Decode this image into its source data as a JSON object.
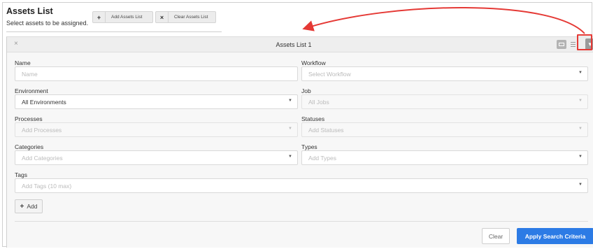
{
  "header": {
    "title": "Assets List",
    "subtitle": "Select assets to be assigned.",
    "add_button": {
      "icon": "+",
      "label": "Add Assets List"
    },
    "clear_button": {
      "icon": "×",
      "label": "Clear Assets List"
    }
  },
  "panel": {
    "close_icon": "×",
    "title": "Assets List 1",
    "filter_icon": "▼"
  },
  "form": {
    "name": {
      "label": "Name",
      "placeholder": "Name"
    },
    "workflow": {
      "label": "Workflow",
      "placeholder": "Select Workflow"
    },
    "environment": {
      "label": "Environment",
      "value": "All Environments"
    },
    "job": {
      "label": "Job",
      "placeholder": "All Jobs"
    },
    "processes": {
      "label": "Processes",
      "placeholder": "Add Processes"
    },
    "statuses": {
      "label": "Statuses",
      "placeholder": "Add Statuses"
    },
    "categories": {
      "label": "Categories",
      "placeholder": "Add Categories"
    },
    "types": {
      "label": "Types",
      "placeholder": "Add Types"
    },
    "tags": {
      "label": "Tags",
      "placeholder": "Add Tags (10 max)"
    },
    "caret_icon": "▼"
  },
  "actions": {
    "add_label": "Add",
    "add_icon": "+",
    "clear_label": "Clear",
    "apply_label": "Apply Search Criteria"
  },
  "colors": {
    "primary": "#2c7be5",
    "annotation": "#e53935"
  }
}
